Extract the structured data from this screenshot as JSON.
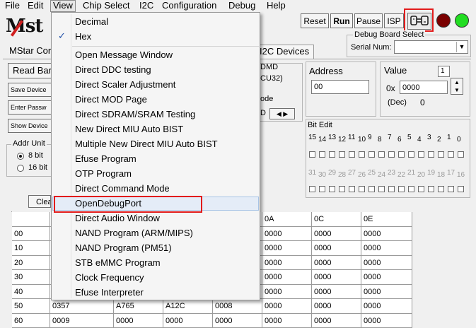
{
  "menubar": {
    "items": [
      "File",
      "Edit",
      "View",
      "Chip Select",
      "I2C",
      "Configuration",
      "Debug",
      "Help"
    ],
    "active": "View"
  },
  "logo_text": "Mst",
  "toolbar": {
    "reset": "Reset",
    "run": "Run",
    "pause": "Pause",
    "isp": "ISP",
    "debug_board_icon": "connect-plug-icon",
    "led_stop_color": "#7a0000",
    "led_go_color": "#22dd22"
  },
  "debug_board": {
    "legend": "Debug Board Select",
    "serial_label": "Serial Num:",
    "serial_value": ""
  },
  "tabs": {
    "mstar": "MStar Cor",
    "i2c_devices": "I2C Devices"
  },
  "left_panel": {
    "read_bank": "Read Bar",
    "save_device": "Save Device",
    "enter_password": "Enter Passw",
    "show_device": "Show Device",
    "addr_unit_legend": "Addr Unit",
    "opt_8bit": "8 bit",
    "opt_16bit": "16 bit",
    "clear": "Clea"
  },
  "mid_panel": {
    "dmd": "DMD",
    "cu32": "CU32)",
    "ode": "ode",
    "d": "D"
  },
  "address": {
    "label": "Address",
    "value": "00"
  },
  "value_box": {
    "label": "Value",
    "spin": "1",
    "prefix": "0x",
    "hex": "0000",
    "dec_label": "(Dec)",
    "dec": "0"
  },
  "bit_edit": {
    "legend": "Bit Edit",
    "top_labels": [
      "15",
      "14",
      "13",
      "12",
      "11",
      "10",
      "9",
      "8",
      "7",
      "6",
      "5",
      "4",
      "3",
      "2",
      "1",
      "0"
    ],
    "bottom_labels": [
      "31",
      "30",
      "29",
      "28",
      "27",
      "26",
      "25",
      "24",
      "23",
      "22",
      "21",
      "20",
      "19",
      "18",
      "17",
      "16"
    ]
  },
  "table": {
    "headers": [
      "",
      "",
      "",
      "",
      "08",
      "0A",
      "0C",
      "0E"
    ],
    "rows": [
      [
        "00",
        "",
        "",
        "",
        "0000",
        "0000",
        "0000",
        "0000"
      ],
      [
        "10",
        "",
        "",
        "",
        "0000",
        "0000",
        "0000",
        "0000"
      ],
      [
        "20",
        "",
        "",
        "",
        "0000",
        "0000",
        "0000",
        "0000"
      ],
      [
        "30",
        "",
        "",
        "",
        "0000",
        "0000",
        "0000",
        "0000"
      ],
      [
        "40",
        "",
        "",
        "",
        "0000",
        "0000",
        "0000",
        "0000"
      ],
      [
        "50",
        "0357",
        "A765",
        "A12C",
        "0008",
        "0000",
        "0000",
        "0000"
      ],
      [
        "60",
        "0009",
        "0000",
        "0000",
        "0000",
        "0000",
        "0000",
        "0000"
      ]
    ]
  },
  "view_menu": {
    "items": [
      {
        "label": "Decimal",
        "checked": false
      },
      {
        "label": "Hex",
        "checked": true
      },
      {
        "label": "Open Message Window",
        "checked": false
      },
      {
        "label": "Direct DDC testing",
        "checked": false
      },
      {
        "label": "Direct Scaler Adjustment",
        "checked": false
      },
      {
        "label": "Direct MOD Page",
        "checked": false
      },
      {
        "label": "Direct SDRAM/SRAM Testing",
        "checked": false
      },
      {
        "label": "New Direct MIU Auto BIST",
        "checked": false
      },
      {
        "label": "Multiple New Direct MIU Auto BIST",
        "checked": false
      },
      {
        "label": "Efuse Program",
        "checked": false
      },
      {
        "label": "OTP Program",
        "checked": false
      },
      {
        "label": "Direct Command Mode",
        "checked": false
      },
      {
        "label": "OpenDebugPort",
        "checked": false
      },
      {
        "label": "Direct Audio Window",
        "checked": false
      },
      {
        "label": "NAND Program (ARM/MIPS)",
        "checked": false
      },
      {
        "label": "NAND Program (PM51)",
        "checked": false
      },
      {
        "label": "STB eMMC Program",
        "checked": false
      },
      {
        "label": "Clock Frequency",
        "checked": false
      },
      {
        "label": "Efuse Interpreter",
        "checked": false
      }
    ],
    "check_glyph": "✓",
    "highlighted": "OpenDebugPort"
  },
  "colors": {
    "highlight_box": "#e21b1b",
    "menu_hover": "#e4ecf7"
  }
}
